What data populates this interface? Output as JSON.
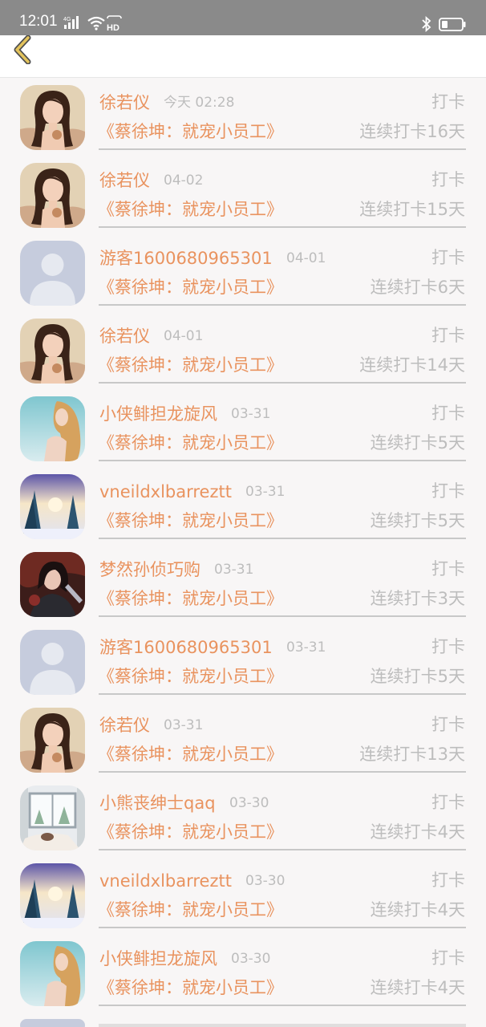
{
  "status_bar": {
    "time": "12:01",
    "net_type": "4G",
    "hd_label": "HD",
    "icons": [
      "signal-icon",
      "wifi-icon",
      "bluetooth-icon",
      "battery-icon"
    ]
  },
  "header": {
    "back_icon": "chevron-left-icon"
  },
  "colors": {
    "accent": "#e9935f",
    "muted": "#bdbdbd",
    "back_icon": "#e3c35c",
    "background": "#f8f6f6"
  },
  "records": [
    {
      "avatar": "girl",
      "name": "徐若仪",
      "date": "今天 02:28",
      "action": "打卡",
      "book": "《蔡徐坤：就宠小员工》",
      "streak": "连续打卡16天"
    },
    {
      "avatar": "girl",
      "name": "徐若仪",
      "date": "04-02",
      "action": "打卡",
      "book": "《蔡徐坤：就宠小员工》",
      "streak": "连续打卡15天"
    },
    {
      "avatar": "guest",
      "name": "游客1600680965301",
      "date": "04-01",
      "action": "打卡",
      "book": "《蔡徐坤：就宠小员工》",
      "streak": "连续打卡6天"
    },
    {
      "avatar": "girl",
      "name": "徐若仪",
      "date": "04-01",
      "action": "打卡",
      "book": "《蔡徐坤：就宠小员工》",
      "streak": "连续打卡14天"
    },
    {
      "avatar": "blonde",
      "name": "小侠鲱担龙旋风",
      "date": "03-31",
      "action": "打卡",
      "book": "《蔡徐坤：就宠小员工》",
      "streak": "连续打卡5天"
    },
    {
      "avatar": "winter",
      "name": "vneildxlbarreztt",
      "date": "03-31",
      "action": "打卡",
      "book": "《蔡徐坤：就宠小员工》",
      "streak": "连续打卡5天"
    },
    {
      "avatar": "warrior",
      "name": "梦然孙侦巧购",
      "date": "03-31",
      "action": "打卡",
      "book": "《蔡徐坤：就宠小员工》",
      "streak": "连续打卡3天"
    },
    {
      "avatar": "guest",
      "name": "游客1600680965301",
      "date": "03-31",
      "action": "打卡",
      "book": "《蔡徐坤：就宠小员工》",
      "streak": "连续打卡5天"
    },
    {
      "avatar": "girl",
      "name": "徐若仪",
      "date": "03-31",
      "action": "打卡",
      "book": "《蔡徐坤：就宠小员工》",
      "streak": "连续打卡13天"
    },
    {
      "avatar": "room",
      "name": "小熊丧绅士qaq",
      "date": "03-30",
      "action": "打卡",
      "book": "《蔡徐坤：就宠小员工》",
      "streak": "连续打卡4天"
    },
    {
      "avatar": "winter",
      "name": "vneildxlbarreztt",
      "date": "03-30",
      "action": "打卡",
      "book": "《蔡徐坤：就宠小员工》",
      "streak": "连续打卡4天"
    },
    {
      "avatar": "blonde",
      "name": "小侠鲱担龙旋风",
      "date": "03-30",
      "action": "打卡",
      "book": "《蔡徐坤：就宠小员工》",
      "streak": "连续打卡4天"
    }
  ]
}
